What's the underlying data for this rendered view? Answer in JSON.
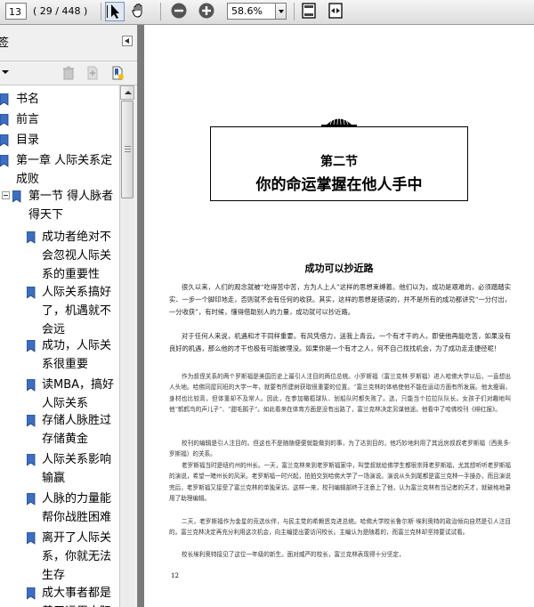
{
  "toolbar": {
    "page_value": "13",
    "page_count": "( 29 / 448 )",
    "zoom_value": "58.6%"
  },
  "sidebar": {
    "title": "签",
    "items": [
      {
        "label": "书名"
      },
      {
        "label": "前言"
      },
      {
        "label": "目录"
      },
      {
        "label": "第一章 人际关系定成败"
      },
      {
        "label": "第一节 得人脉者得天下"
      },
      {
        "label": "成功者绝对不会忽视人际关系的重要性"
      },
      {
        "label": "人际关系搞好了，机遇就不会远"
      },
      {
        "label": "成功，人际关系很重要"
      },
      {
        "label": "读MBA，搞好人际关系"
      },
      {
        "label": "存储人脉胜过存储黄金"
      },
      {
        "label": "人际关系影响输赢"
      },
      {
        "label": "人脉的力量能帮你战胜困难"
      },
      {
        "label": "离开了人际关系，你就无法生存"
      },
      {
        "label": "成大事者都是善于运用人际"
      }
    ]
  },
  "document": {
    "section_number": "第二节",
    "section_title": "你的命运掌握在他人手中",
    "subheading": "成功可以抄近路",
    "para1": "很久以来，人们的观念就被“吃得苦中苦，方为人上人”这样的思想束缚着。他们以为，成功是艰难的，必须踏踏实实、一步一个脚印地走，否则就不会有任何的收获。其实，这样的思想是错误的，并不是所有的成功都讲究“一分付出，一分收获”，有时候，懂得借助别人的力量，成功就可以抄近路。",
    "para2": "对于任何人来说，机遇和才干同样重要。有风凭借力，送我上青云。一个有才干的人，即使他再能吃苦，如果没有良好的机遇，那么他的才干也极有可能被埋没。如果你是一个有才之人，何不自己找找机会，为了成功走走捷径呢！",
    "para3": "作为叔侄关系的两个罗斯福是美国历史上最引人注目的两位总统。小罗斯福（富兰克林·罗斯福）进入哈佛大学以后，一直想出人头地。哈佛同屋同班的大学一年，就要有所建树获取很重要的位置。“富兰克林的体格使他不能在运动方面有所发展。他太瘦弱，身材也比较高，但体重却不及常人。因此，在参加橄榄球队、划船队时都失败了。选，只能当个拉拉队队长。女孩子们对趣地叫他“鹤鹤鸟的声儿子”、“甜毛鹅子”。如此看来在体育方面是没有出路了，富兰克林决定另谋他途。他看中了哈佛校刊《绯红报》。",
    "para4": "校刊的编辑是引人注目的。但这也不是随随便便就能做到的事，为了达到目的，他巧妙地利用了其远房叔叔老罗斯福（西奥多·罗斯福）的关系。",
    "para5": "老罗斯福当时是纽约州的州长。一天，富兰克林来到老罗斯福家中，叫堂叔就给佛学生都很崇拜老罗斯福，尤其想听听老罗斯福的演说，希望一睹州长的风采。老罗斯福一时兴起，拍拍交到哈佛大学了一场演说。演说从头到尾都是富兰克林一手操办，而且演说完后，老罗斯福又接受了富兰克林的单独采访。这样一来，校刊编辑部终于注意上了他，认为富兰克林有当记者的天才，就破格地录用了助理编辑。",
    "para6": "二天，老罗斯福作为金星的竞选伙伴，与民主党的希赖恩克进总统。哈佛大学校长鲁尔斯·埃利奥特的政治倾向自然是引人注目的。富兰克林决定再充分利用这次机会，向主编提出要访问校长。主编认为是随着的，而富兰克林却坚持要试试看。",
    "para7": "校长埃利奥特接见了这位一年级的新生。面对威严的校长，富兰克林表现得十分坚定，",
    "page_number": "12"
  }
}
